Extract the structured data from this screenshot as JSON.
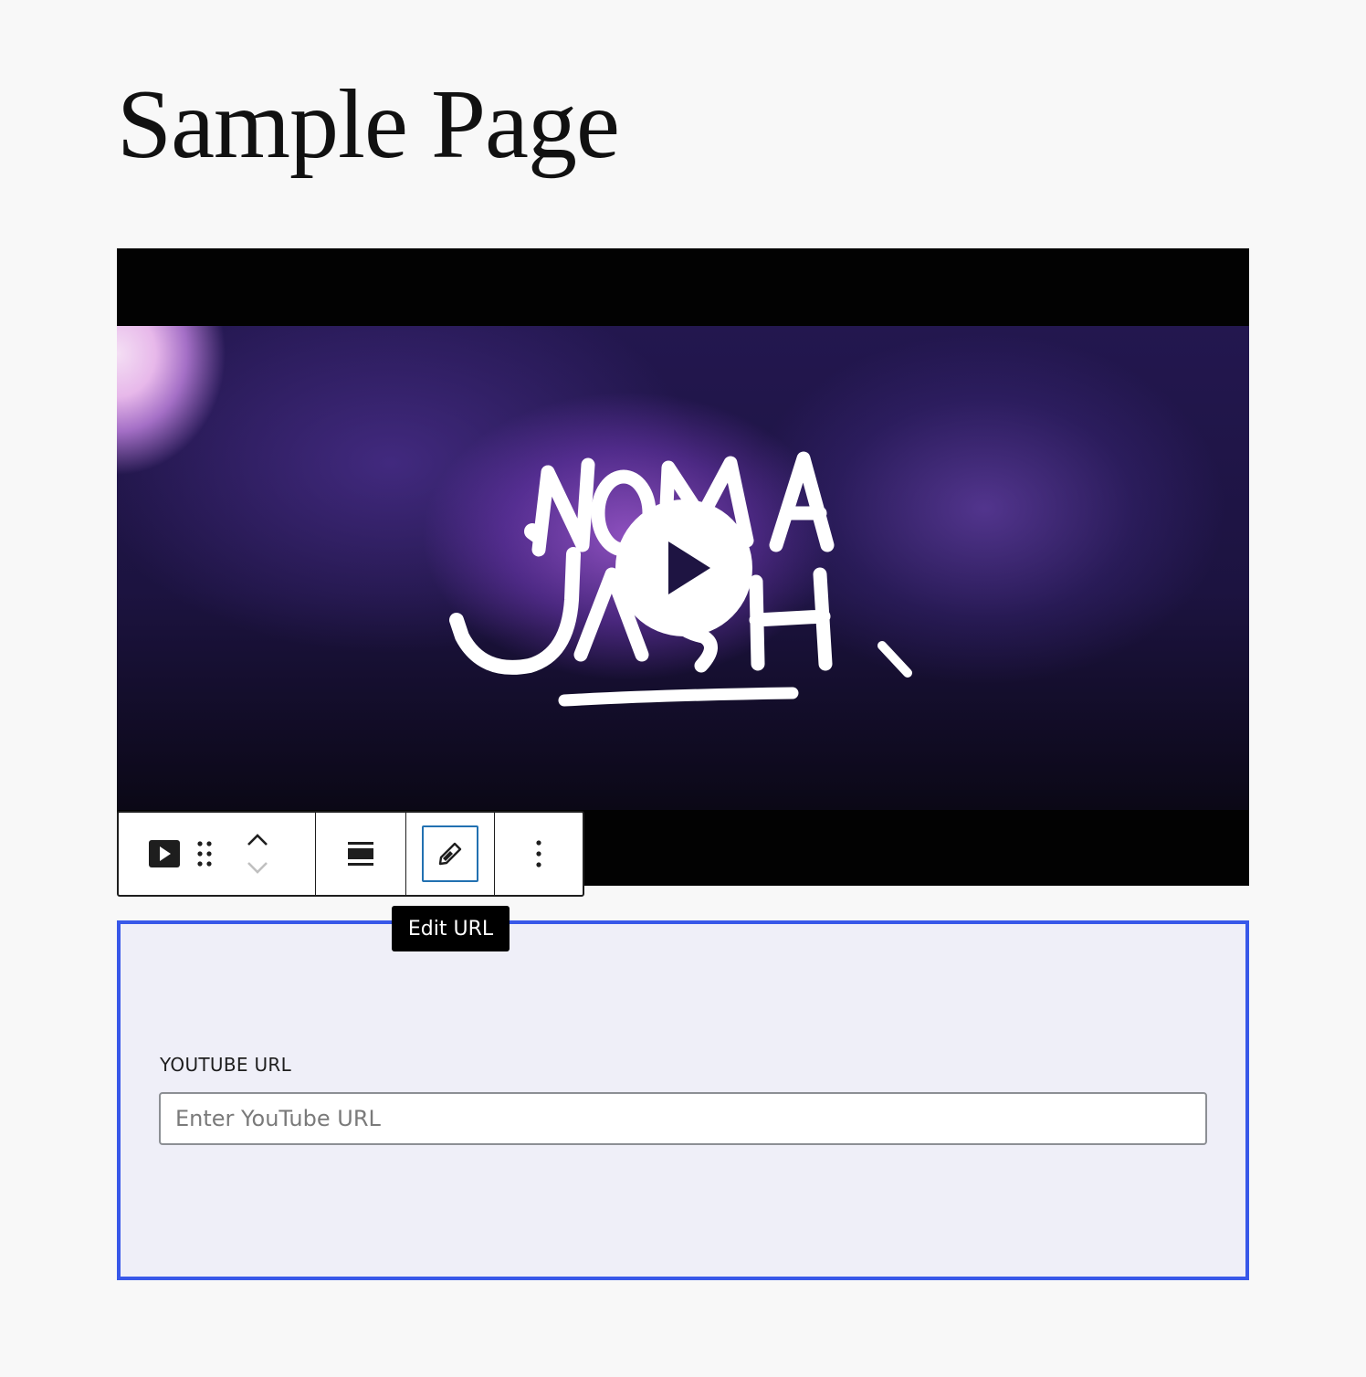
{
  "page": {
    "title": "Sample Page"
  },
  "video": {
    "logo_lines": [
      "NOMA",
      "JASH."
    ]
  },
  "toolbar": {
    "tooltip": "Edit URL"
  },
  "url_panel": {
    "label": "YOUTUBE URL",
    "input_value": "",
    "input_placeholder": "Enter YouTube URL"
  },
  "colors": {
    "selection_border": "#3858e9",
    "focus_ring": "#2271b1",
    "panel_background": "#efeff8"
  }
}
